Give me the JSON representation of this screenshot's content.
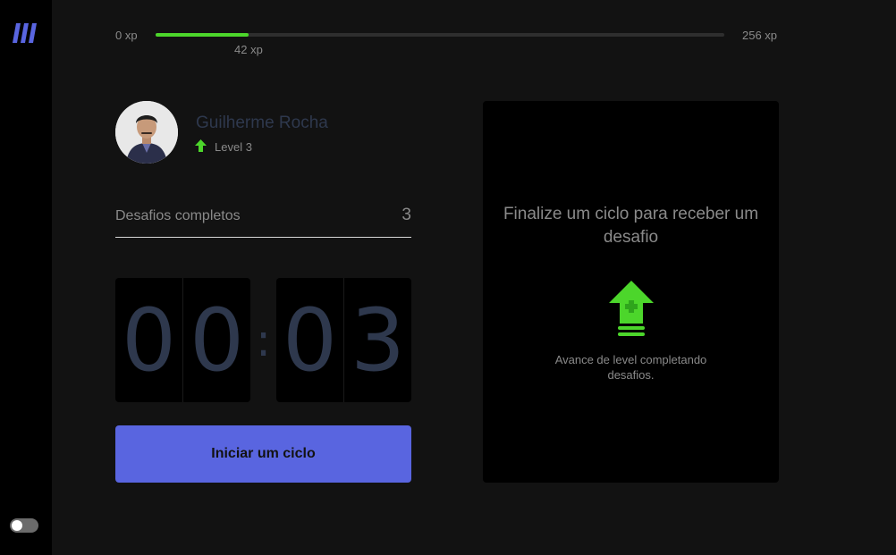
{
  "app": {
    "logo": "move-it-logo-icon",
    "accent_color": "#5965e0",
    "success_color": "#4cd62b"
  },
  "sidebar": {
    "theme_toggle": {
      "icon": "toggle-switch-icon",
      "state": "off"
    }
  },
  "experience": {
    "min_label": "0 xp",
    "max_label": "256 xp",
    "current_label": "42 xp",
    "current": 42,
    "max": 256
  },
  "profile": {
    "name": "Guilherme Rocha",
    "level_label": "Level 3",
    "level_icon": "level-up-arrow-icon",
    "avatar": "avatar"
  },
  "challenges_completed": {
    "label": "Desafios completos",
    "count": "3"
  },
  "countdown": {
    "minute_tens": "0",
    "minute_ones": "0",
    "separator": ":",
    "second_tens": "0",
    "second_ones": "3"
  },
  "start_button": {
    "label": "Iniciar um ciclo"
  },
  "challenge_box": {
    "title": "Finalize um ciclo para receber um desafio",
    "icon": "level-up-icon",
    "description": "Avance de level completando desafios."
  }
}
